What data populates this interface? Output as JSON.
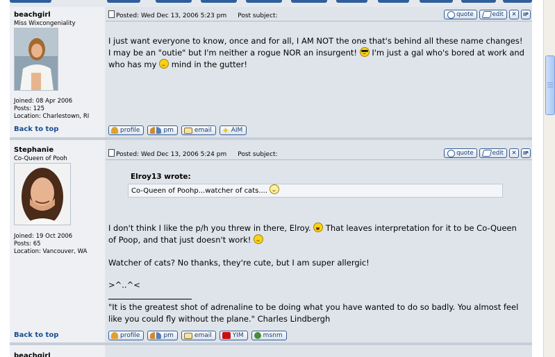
{
  "posts": [
    {
      "username": "beachgirl",
      "user_title": "Miss Wixcongeniality",
      "joined": "Joined: 08 Apr 2006",
      "posts": "Posts: 125",
      "location": "Location: Charlestown, RI",
      "posted": "Posted: Wed Dec 13, 2006 5:23 pm",
      "subject": "Post subject:",
      "body_1": "I just want everyone to know, once and for all, I AM NOT the one that's behind all these name changes! I may be an \"outie\" but I'm neither a rogue NOR an insurgent!",
      "body_2": "I'm just a gal who's bored at work and who has my",
      "body_3": "mind in the gutter!",
      "back_to_top": "Back to top",
      "footer_buttons": [
        "profile",
        "pm",
        "email",
        "AIM"
      ]
    },
    {
      "username": "Stephanie",
      "user_title": "Co-Queen of Pooh",
      "joined": "Joined: 19 Oct 2006",
      "posts": "Posts: 65",
      "location": "Location: Vancouver, WA",
      "posted": "Posted: Wed Dec 13, 2006 5:24 pm",
      "subject": "Post subject:",
      "quote_author": "Elroy13 wrote:",
      "quote_text": "Co-Queen of Poohp...watcher of cats....",
      "body_1": "I don't think I like the p/h you threw in there, Elroy.",
      "body_2": "That leaves interpretation for it to be Co-Queen of Poop, and that just doesn't work!",
      "body_3": "Watcher of cats? No thanks, they're cute, but I am super allergic!",
      "body_4": ">^..^<",
      "signature": "\"It is the greatest shot of adrenaline to be doing what you have wanted to do so badly. You almost feel like you could fly without the plane.\" Charles Lindbergh",
      "back_to_top": "Back to top",
      "footer_buttons": [
        "profile",
        "pm",
        "email",
        "YIM",
        "msnm"
      ]
    }
  ],
  "post_buttons": {
    "quote": "quote",
    "edit": "edit",
    "delete": "✕",
    "ip": "IP"
  },
  "next_username": "beachgirl"
}
